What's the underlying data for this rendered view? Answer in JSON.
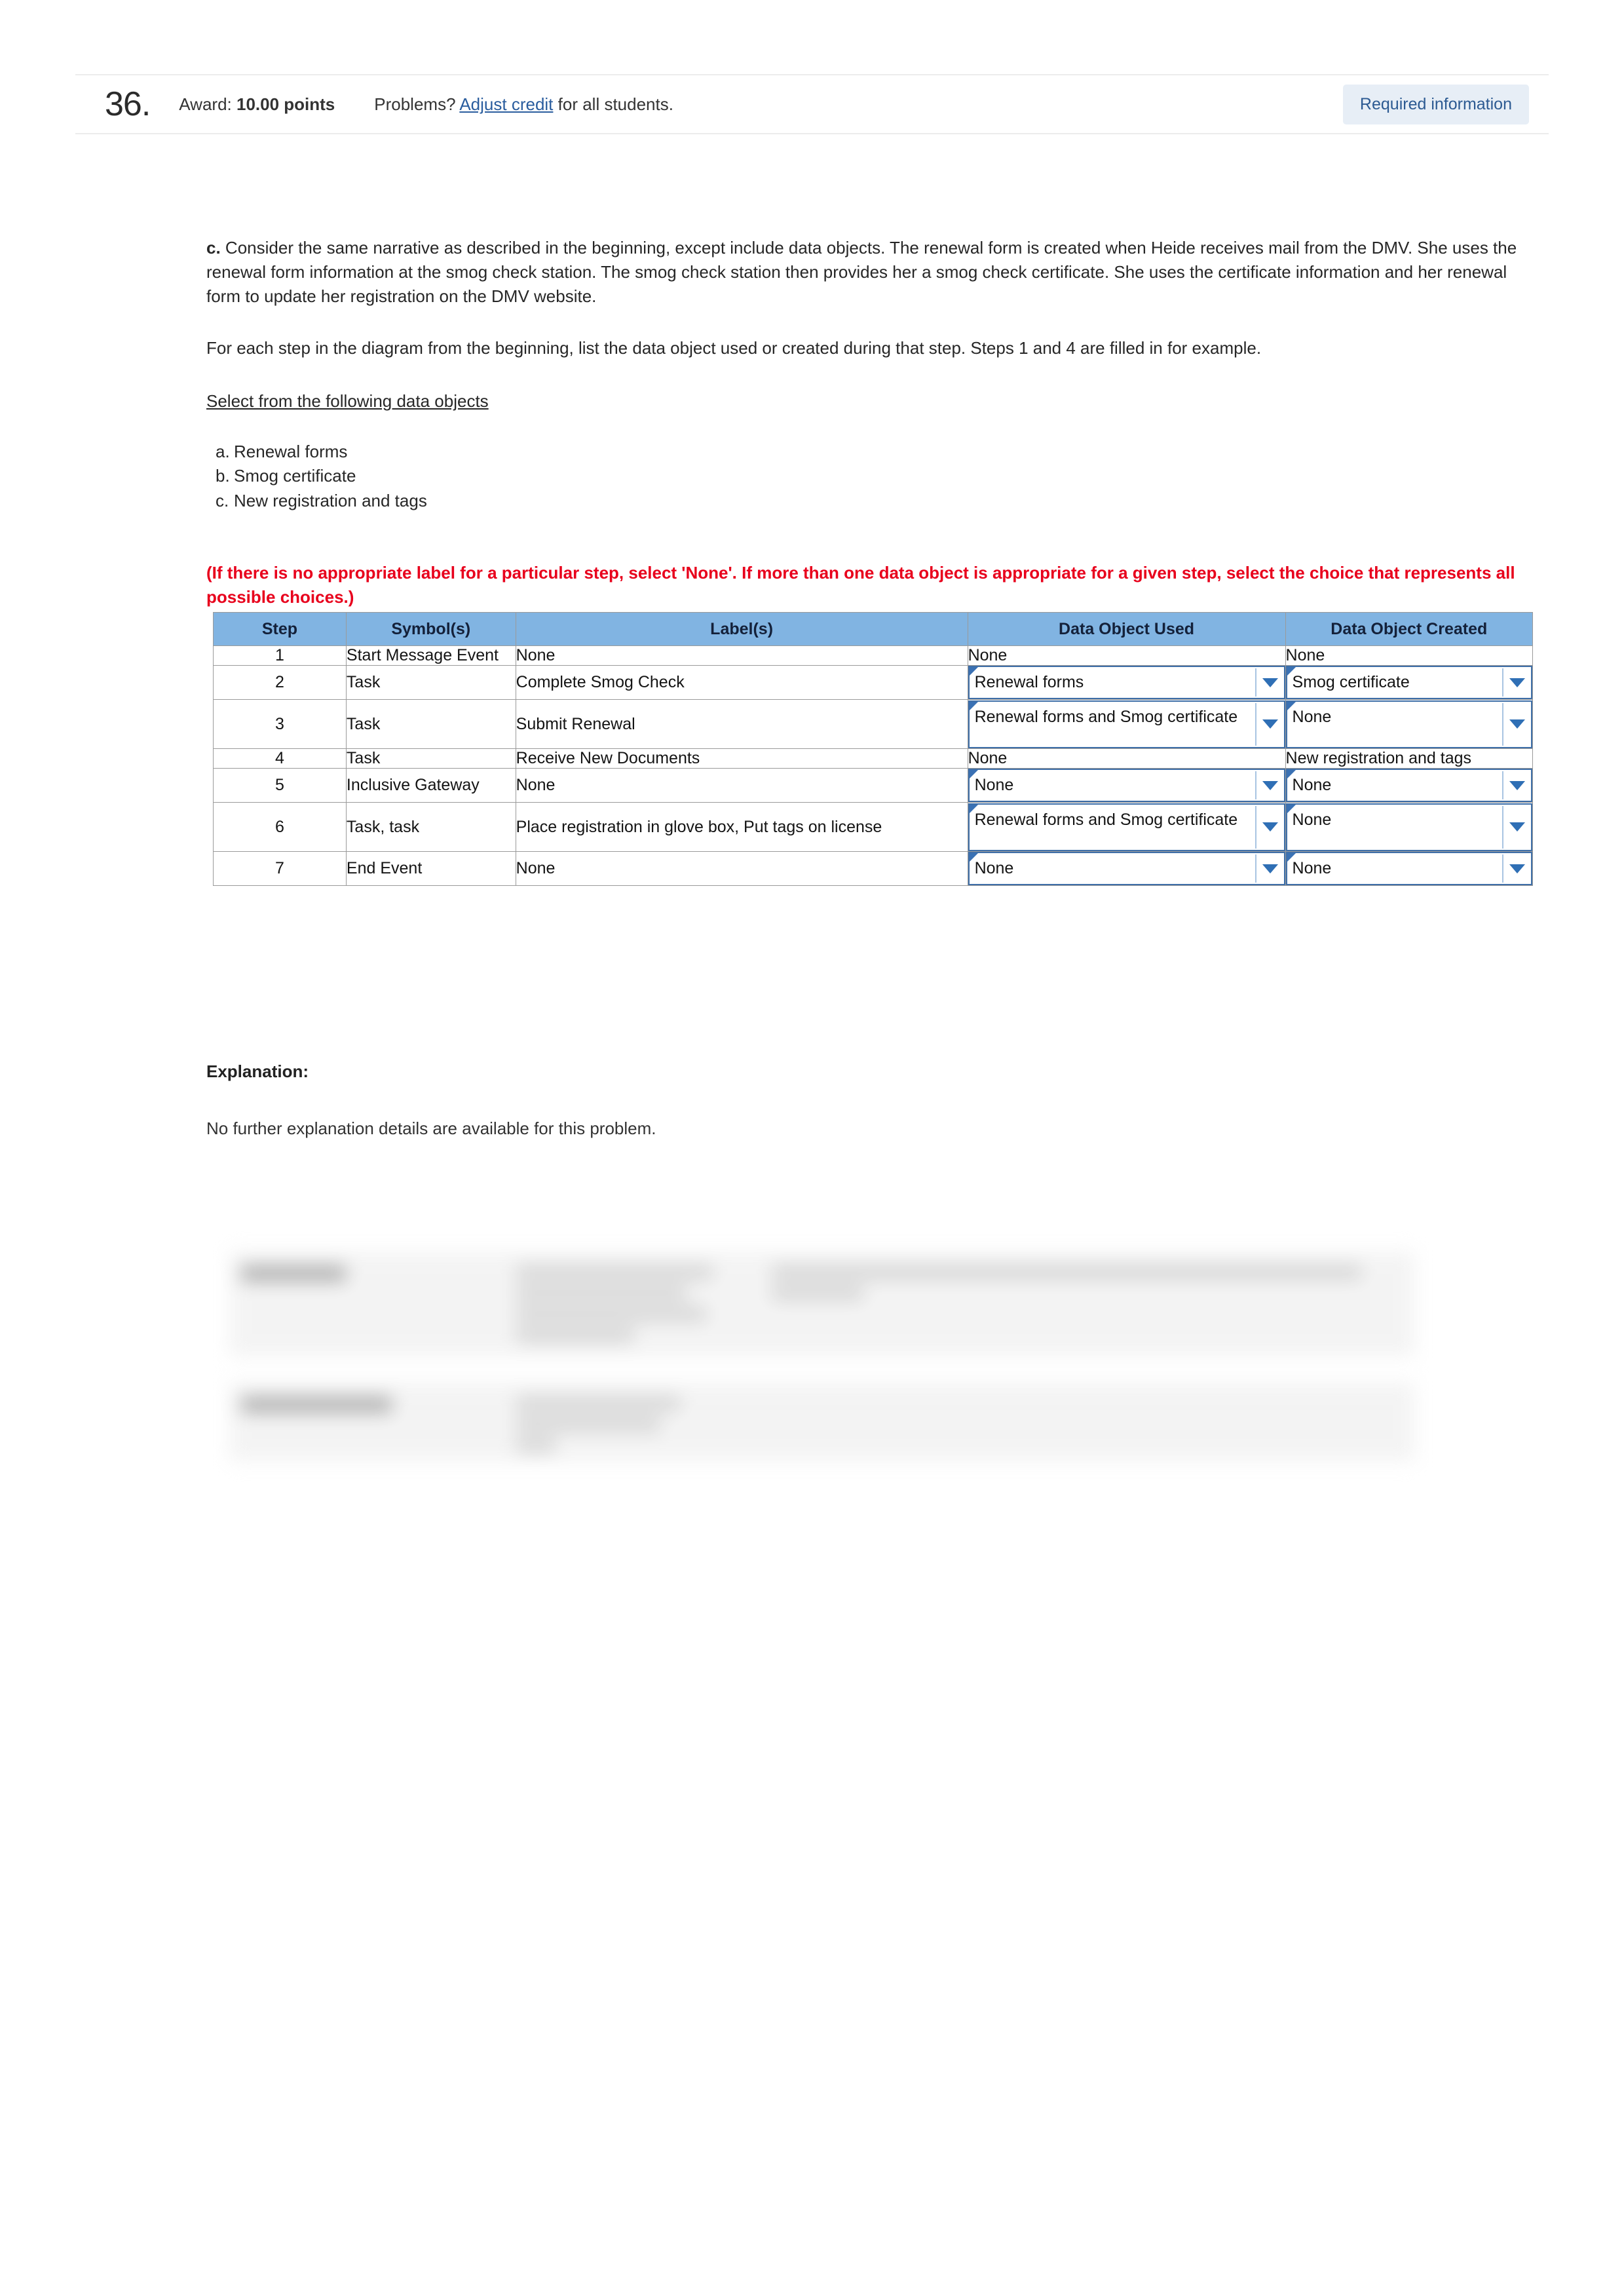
{
  "header": {
    "question_number": "36.",
    "award_label": "Award:",
    "award_value": "10.00 points",
    "problems_label": "Problems?",
    "adjust_credit_link": "Adjust credit",
    "problems_suffix": "for all students.",
    "required_badge": "Required information"
  },
  "body": {
    "part_letter": "c.",
    "prompt": "Consider the same narrative as described in the beginning, except include data objects. The renewal form is created when Heide receives mail from the DMV. She uses the renewal form information at the smog check station. The smog check station then provides her a smog check certificate. She uses the certificate information and her renewal form to update her registration on the DMV website.",
    "instruction": "For each step in the diagram from the beginning, list the data object used or created during that step. Steps 1 and 4 are filled in for example.",
    "select_heading": "Select from the following data objects",
    "choices": [
      {
        "marker": "a.",
        "label": "Renewal forms"
      },
      {
        "marker": "b.",
        "label": "Smog certificate"
      },
      {
        "marker": "c.",
        "label": "New registration and tags"
      }
    ],
    "warning": "(If there is no appropriate label for a particular step, select 'None'. If more than one data object is appropriate for a given step, select the choice that represents all possible choices.)"
  },
  "table": {
    "columns": [
      "Step",
      "Symbol(s)",
      "Label(s)",
      "Data Object Used",
      "Data Object Created"
    ],
    "rows": [
      {
        "step": "1",
        "symbol": "Start Message Event",
        "label": "None",
        "used": {
          "value": "None",
          "type": "text"
        },
        "created": {
          "value": "None",
          "type": "text"
        }
      },
      {
        "step": "2",
        "symbol": "Task",
        "label": "Complete Smog Check",
        "used": {
          "value": "Renewal forms",
          "type": "select"
        },
        "created": {
          "value": "Smog certificate",
          "type": "select"
        }
      },
      {
        "step": "3",
        "symbol": "Task",
        "label": "Submit Renewal",
        "used": {
          "value": "Renewal forms and Smog certificate",
          "type": "select"
        },
        "created": {
          "value": "None",
          "type": "select"
        }
      },
      {
        "step": "4",
        "symbol": "Task",
        "label": "Receive New Documents",
        "used": {
          "value": "None",
          "type": "text"
        },
        "created": {
          "value": "New registration and tags",
          "type": "text"
        }
      },
      {
        "step": "5",
        "symbol": "Inclusive Gateway",
        "label": "None",
        "used": {
          "value": "None",
          "type": "select"
        },
        "created": {
          "value": "None",
          "type": "select"
        }
      },
      {
        "step": "6",
        "symbol": "Task, task",
        "label": "Place registration in glove box, Put tags on license",
        "used": {
          "value": "Renewal forms and Smog certificate",
          "type": "select"
        },
        "created": {
          "value": "None",
          "type": "select"
        }
      },
      {
        "step": "7",
        "symbol": "End Event",
        "label": "None",
        "used": {
          "value": "None",
          "type": "select"
        },
        "created": {
          "value": "None",
          "type": "select"
        }
      }
    ]
  },
  "explanation": {
    "heading": "Explanation:",
    "text": "No further explanation details are available for this problem."
  },
  "colors": {
    "table_header_bg": "#81b4e2",
    "select_border": "#3f6fa8",
    "select_arrow": "#2f6fb5",
    "warning_text": "#e8001c",
    "link": "#2a5d9e",
    "badge_bg": "#e7eef6",
    "badge_text": "#2c5a92"
  }
}
